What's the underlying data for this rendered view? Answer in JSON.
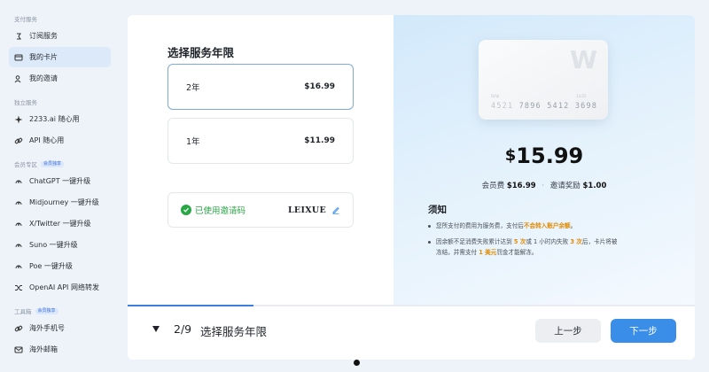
{
  "sidebar": {
    "sections": [
      {
        "title": "支付服务",
        "badge": "",
        "items": [
          {
            "label": "订阅服务",
            "icon": "subscription-icon",
            "active": false
          },
          {
            "label": "我的卡片",
            "icon": "card-icon",
            "active": true
          },
          {
            "label": "我的邀请",
            "icon": "user-invite-icon",
            "active": false
          }
        ]
      },
      {
        "title": "独立服务",
        "badge": "",
        "items": [
          {
            "label": "2233.ai 随心用",
            "icon": "sparkle-icon",
            "active": false
          },
          {
            "label": "API 随心用",
            "icon": "link-icon",
            "active": false
          }
        ]
      },
      {
        "title": "会员专区",
        "badge": "会员独享",
        "items": [
          {
            "label": "ChatGPT 一键升级",
            "icon": "upgrade-icon",
            "active": false
          },
          {
            "label": "Midjourney 一键升级",
            "icon": "upgrade-icon",
            "active": false
          },
          {
            "label": "X/Twitter 一键升级",
            "icon": "upgrade-icon",
            "active": false
          },
          {
            "label": "Suno 一键升级",
            "icon": "upgrade-icon",
            "active": false
          },
          {
            "label": "Poe 一键升级",
            "icon": "upgrade-icon",
            "active": false
          },
          {
            "label": "OpenAI API 网络转发",
            "icon": "shuffle-icon",
            "active": false
          }
        ]
      },
      {
        "title": "工具箱",
        "badge": "会员独享",
        "items": [
          {
            "label": "海外手机号",
            "icon": "link-icon",
            "active": false
          },
          {
            "label": "海外邮箱",
            "icon": "mail-icon",
            "active": false
          }
        ]
      }
    ]
  },
  "plan": {
    "title": "选择服务年限",
    "options": [
      {
        "label": "2年",
        "price": "$16.99",
        "selected": true
      },
      {
        "label": "1年",
        "price": "$11.99",
        "selected": false
      }
    ],
    "invite_label": "已使用邀请码",
    "invite_code": "LEIXUE"
  },
  "card": {
    "logo": "W",
    "small_left": "DIAJI",
    "small_right": "12/25",
    "number_groups": [
      "4521",
      "7896",
      "5412",
      "3698"
    ]
  },
  "summary": {
    "currency": "$",
    "price": "15.99",
    "member_fee_label": "会员费",
    "member_fee": "$16.99",
    "separator": "·",
    "reward_label": "邀请奖励",
    "reward": "$1.00"
  },
  "notice": {
    "title": "须知",
    "item1_a": "您所支付的费用为服务费，支付后",
    "item1_hl": "不会转入账户余额",
    "item1_b": "。",
    "item2_a": "因余额不足消费失败累计达到",
    "item2_hl1": "5 次",
    "item2_b": "或 1 小时内失败",
    "item2_hl2": "3 次",
    "item2_c": "后，卡片将被",
    "item2_line2_a": "冻结，并需支付",
    "item2_hl3": "1 美元",
    "item2_line2_b": "罚金才能解冻。"
  },
  "footer": {
    "step": "2/9",
    "step_title": "选择服务年限",
    "progress": 0.222,
    "prev_label": "上一步",
    "next_label": "下一步"
  },
  "colors": {
    "accent": "#3b8ee8",
    "success": "#28a745",
    "highlight": "#e08a00"
  }
}
